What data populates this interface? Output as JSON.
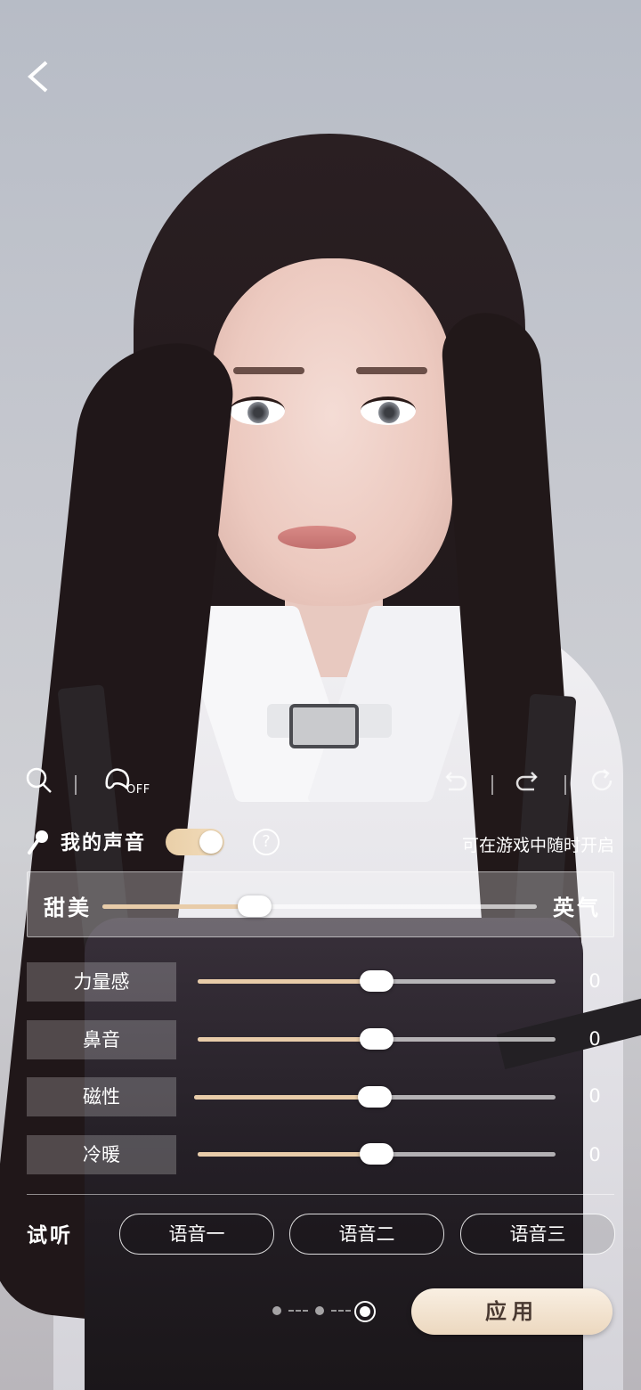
{
  "toolbar": {
    "off_label": "OFF"
  },
  "voice": {
    "label": "我的声音",
    "toggle_on": true,
    "help": "?",
    "hint": "可在游戏中随时开启"
  },
  "sweet_slider": {
    "left_label": "甜美",
    "right_label": "英气",
    "value": 0.35
  },
  "params": [
    {
      "label": "力量感",
      "value": "0",
      "position": 0.5
    },
    {
      "label": "鼻音",
      "value": "0",
      "position": 0.5
    },
    {
      "label": "磁性",
      "value": "0",
      "position": 0.5
    },
    {
      "label": "冷暖",
      "value": "0",
      "position": 0.5
    }
  ],
  "preview": {
    "label": "试听",
    "buttons": [
      "语音一",
      "语音二",
      "语音三"
    ]
  },
  "pagination": {
    "current": 3,
    "total": 3
  },
  "apply_label": "应用",
  "colors": {
    "accent": "#e8cca9",
    "apply_bg": "#f3e4d0"
  }
}
